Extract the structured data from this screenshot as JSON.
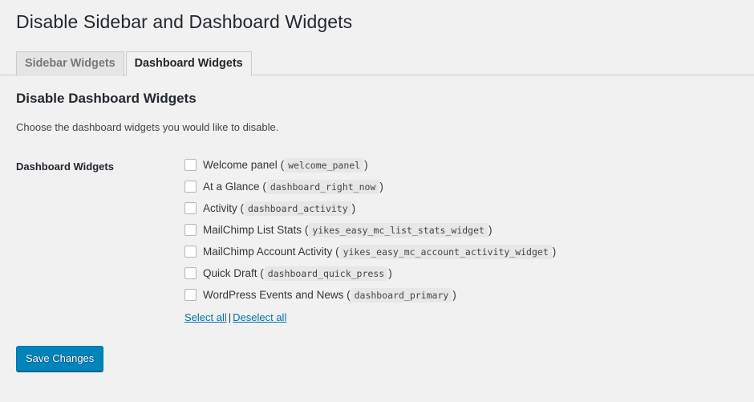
{
  "page": {
    "title": "Disable Sidebar and Dashboard Widgets"
  },
  "tabs": [
    {
      "label": "Sidebar Widgets",
      "active": false
    },
    {
      "label": "Dashboard Widgets",
      "active": true
    }
  ],
  "section": {
    "heading": "Disable Dashboard Widgets",
    "description": "Choose the dashboard widgets you would like to disable.",
    "field_label": "Dashboard Widgets"
  },
  "widgets": [
    {
      "name": "Welcome panel",
      "slug": "welcome_panel",
      "checked": false
    },
    {
      "name": "At a Glance",
      "slug": "dashboard_right_now",
      "checked": false
    },
    {
      "name": "Activity",
      "slug": "dashboard_activity",
      "checked": false
    },
    {
      "name": "MailChimp List Stats",
      "slug": "yikes_easy_mc_list_stats_widget",
      "checked": false
    },
    {
      "name": "MailChimp Account Activity",
      "slug": "yikes_easy_mc_account_activity_widget",
      "checked": false
    },
    {
      "name": "Quick Draft",
      "slug": "dashboard_quick_press",
      "checked": false
    },
    {
      "name": "WordPress Events and News",
      "slug": "dashboard_primary",
      "checked": false
    }
  ],
  "links": {
    "select_all": "Select all",
    "separator": "|",
    "deselect_all": "Deselect all"
  },
  "submit": {
    "label": "Save Changes"
  },
  "colors": {
    "page_background": "#f1f1f1",
    "primary_button": "#0085ba",
    "link": "#0073aa",
    "text": "#23282d",
    "code_background": "#e7e7e7",
    "tab_inactive_background": "#e5e5e5",
    "border": "#cccccc"
  },
  "punctuation": {
    "open_paren": "(",
    "close_paren": ")"
  }
}
